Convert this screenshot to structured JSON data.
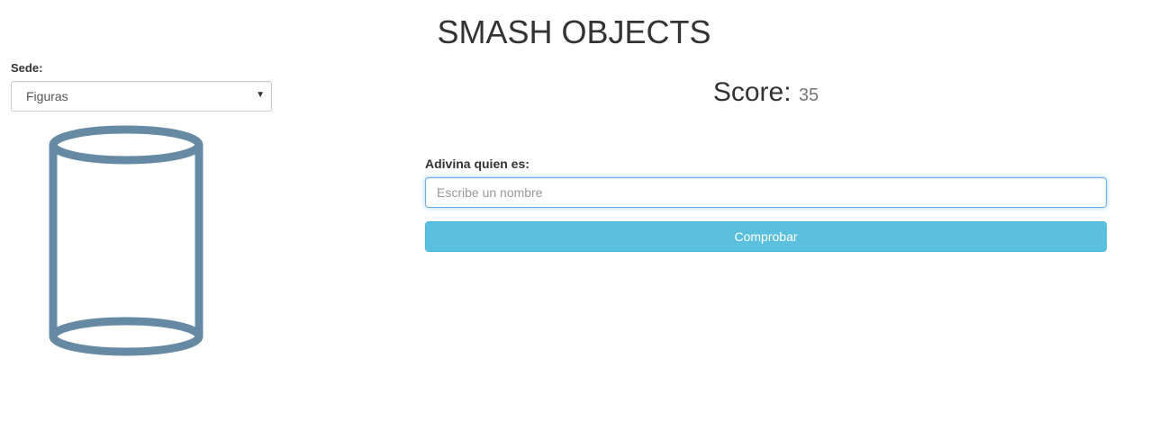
{
  "header": {
    "title": "SMASH OBJECTS"
  },
  "sidebar": {
    "sede_label": "Sede:",
    "sede_selected": "Figuras",
    "shape_icon": "cylinder-icon",
    "shape_color": "#678aa4"
  },
  "main": {
    "score_label": "Score:",
    "score_value": "35",
    "guess_label": "Adivina quien es:",
    "guess_value": "",
    "guess_placeholder": "Escribe un nombre",
    "check_button_label": "Comprobar",
    "button_color": "#5bc0de"
  }
}
